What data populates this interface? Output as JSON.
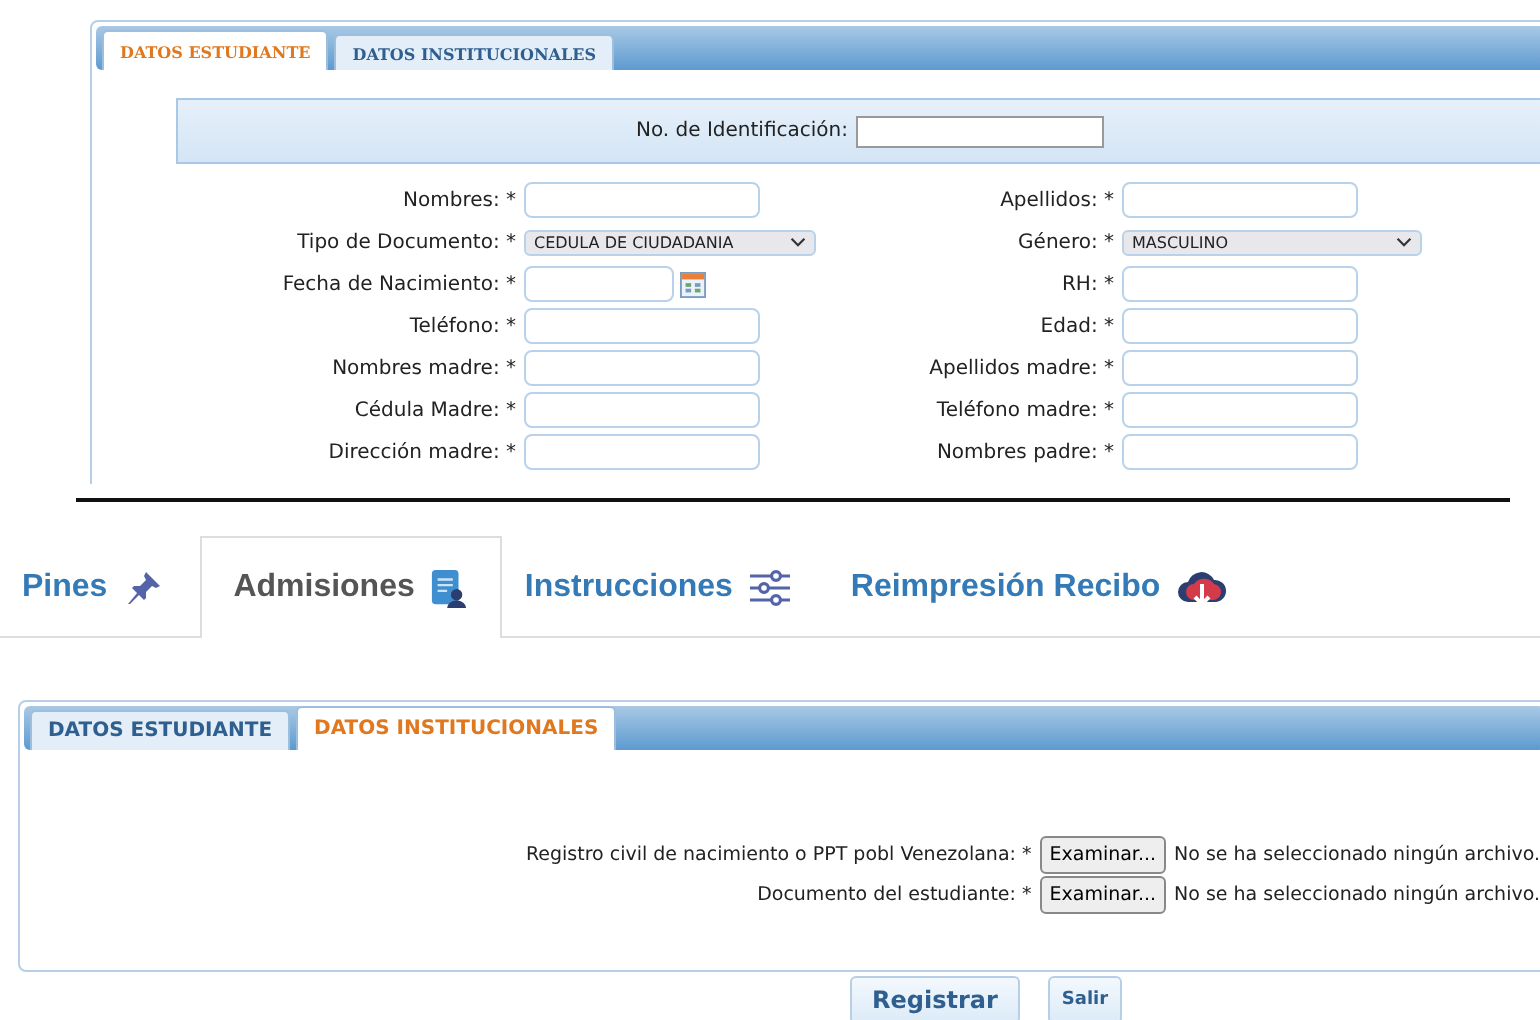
{
  "top_form": {
    "tabs": [
      {
        "label": "DATOS ESTUDIANTE",
        "selected": true
      },
      {
        "label": "DATOS INSTITUCIONALES",
        "selected": false
      }
    ],
    "id_label": "No. de Identificación:",
    "rows": [
      {
        "left": {
          "label": "Nombres: *",
          "kind": "text"
        },
        "right": {
          "label": "Apellidos: *",
          "kind": "text"
        }
      },
      {
        "left": {
          "label": "Tipo de Documento: *",
          "kind": "select",
          "value": "CEDULA DE CIUDADANIA"
        },
        "right": {
          "label": "Género: *",
          "kind": "select",
          "value": "MASCULINO"
        }
      },
      {
        "left": {
          "label": "Fecha de Nacimiento: *",
          "kind": "date"
        },
        "right": {
          "label": "RH: *",
          "kind": "text"
        }
      },
      {
        "left": {
          "label": "Teléfono: *",
          "kind": "text"
        },
        "right": {
          "label": "Edad: *",
          "kind": "text"
        }
      },
      {
        "left": {
          "label": "Nombres madre: *",
          "kind": "text"
        },
        "right": {
          "label": "Apellidos madre: *",
          "kind": "text"
        }
      },
      {
        "left": {
          "label": "Cédula Madre: *",
          "kind": "text"
        },
        "right": {
          "label": "Teléfono madre: *",
          "kind": "text"
        }
      },
      {
        "left": {
          "label": "Dirección madre: *",
          "kind": "text"
        },
        "right": {
          "label": "Nombres padre: *",
          "kind": "text"
        }
      }
    ]
  },
  "nav_tabs": [
    {
      "label": "Pines",
      "selected": false
    },
    {
      "label": "Admisiones",
      "selected": true
    },
    {
      "label": "Instrucciones",
      "selected": false
    },
    {
      "label": "Reimpresión Recibo",
      "selected": false
    }
  ],
  "bottom_form": {
    "tabs": [
      {
        "label": "DATOS ESTUDIANTE",
        "selected": false
      },
      {
        "label": "DATOS INSTITUCIONALES",
        "selected": true
      }
    ],
    "file_fields": [
      {
        "label": "Registro civil de nacimiento o PPT pobl Venezolana: *",
        "button": "Examinar...",
        "status": "No se ha seleccionado ningún archivo."
      },
      {
        "label": "Documento del estudiante: *",
        "button": "Examinar...",
        "status": "No se ha seleccionado ningún archivo."
      }
    ]
  },
  "buttons": [
    {
      "label": "Registrar",
      "kind": "primary"
    },
    {
      "label": "Salir",
      "kind": "secondary"
    }
  ]
}
